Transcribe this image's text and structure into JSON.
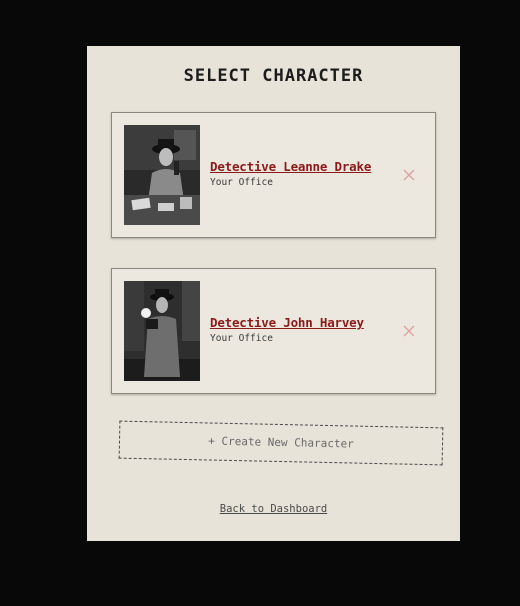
{
  "page": {
    "title": "SELECT CHARACTER"
  },
  "characters": [
    {
      "name": "Detective Leanne Drake",
      "location": "Your Office",
      "portrait": "noir-woman-at-desk-photo",
      "remove_icon": "close-icon"
    },
    {
      "name": "Detective John Harvey",
      "location": "Your Office",
      "portrait": "noir-man-with-camera-photo",
      "remove_icon": "close-icon"
    }
  ],
  "actions": {
    "create_label": "+ Create New Character",
    "back_label": "Back to Dashboard"
  },
  "colors": {
    "background": "#080808",
    "panel": "#e7e3d8",
    "card": "#ece8df",
    "name_accent": "#8b1a1a",
    "remove_icon": "#e0a0a0"
  }
}
